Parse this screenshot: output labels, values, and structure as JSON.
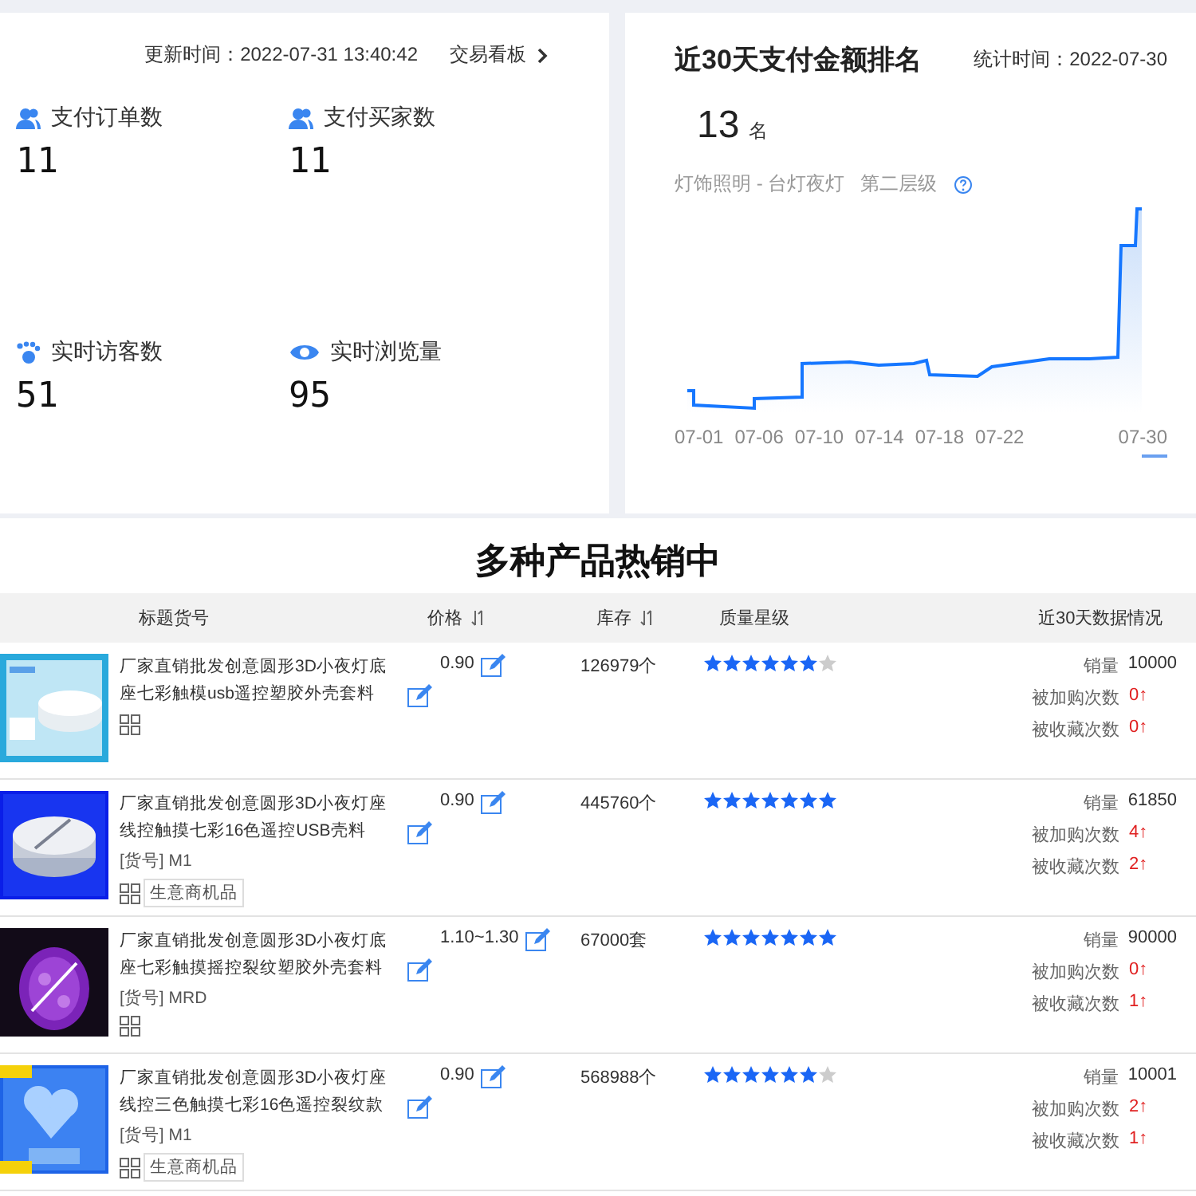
{
  "overview": {
    "update_time": "更新时间：2022-07-31 13:40:42",
    "board_link": "交易看板",
    "metrics": [
      {
        "kind": "users",
        "label": "支付订单数",
        "value": "11"
      },
      {
        "kind": "users",
        "label": "支付买家数",
        "value": "11"
      },
      {
        "kind": "footprint",
        "label": "实时访客数",
        "value": "51"
      },
      {
        "kind": "eye",
        "label": "实时浏览量",
        "value": "95"
      }
    ]
  },
  "ranking": {
    "title": "近30天支付金额排名",
    "stat_time": "统计时间：2022-07-30",
    "rank": "13",
    "rank_unit": "名",
    "category": "灯饰照明 - 台灯夜灯",
    "level": "第二层级",
    "x_labels": [
      "07-01",
      "07-06",
      "07-10",
      "07-14",
      "07-18",
      "07-22",
      "07-30"
    ]
  },
  "banner": "多种产品热销中",
  "table": {
    "columns": [
      {
        "label": "标题货号",
        "sortable": false
      },
      {
        "label": "价格",
        "sortable": true
      },
      {
        "label": "库存",
        "sortable": true
      },
      {
        "label": "质量星级",
        "sortable": false
      },
      {
        "label": "近30天数据情况",
        "sortable": false
      }
    ],
    "rows": [
      {
        "title": "厂家直销批发创意圆形3D小夜灯底座七彩触模usb遥控塑胶外壳套料",
        "price": "0.90",
        "stock": "126979个",
        "stars": 6,
        "sales_label": "销量",
        "sales": "10000",
        "cart_label": "被加购次数",
        "cart": "0↑",
        "fav_label": "被收藏次数",
        "fav": "0↑"
      },
      {
        "title": "厂家直销批发创意圆形3D小夜灯座线控触摸七彩16色遥控USB壳料",
        "sku": "[货号] M1",
        "tag": "生意商机品",
        "price": "0.90",
        "stock": "445760个",
        "stars": 7,
        "sales_label": "销量",
        "sales": "61850",
        "cart_label": "被加购次数",
        "cart": "4↑",
        "fav_label": "被收藏次数",
        "fav": "2↑"
      },
      {
        "title": "厂家直销批发创意圆形3D小夜灯底座七彩触摸摇控裂纹塑胶外壳套料",
        "sku": "[货号] MRD",
        "price": "1.10~1.30",
        "stock": "67000套",
        "stars": 7,
        "sales_label": "销量",
        "sales": "90000",
        "cart_label": "被加购次数",
        "cart": "0↑",
        "fav_label": "被收藏次数",
        "fav": "1↑"
      },
      {
        "title": "厂家直销批发创意圆形3D小夜灯座线控三色触摸七彩16色遥控裂纹款",
        "sku": "[货号] M1",
        "tag": "生意商机品",
        "price": "0.90",
        "stock": "568988个",
        "stars": 6,
        "sales_label": "销量",
        "sales": "10001",
        "cart_label": "被加购次数",
        "cart": "2↑",
        "fav_label": "被收藏次数",
        "fav": "1↑"
      }
    ]
  }
}
